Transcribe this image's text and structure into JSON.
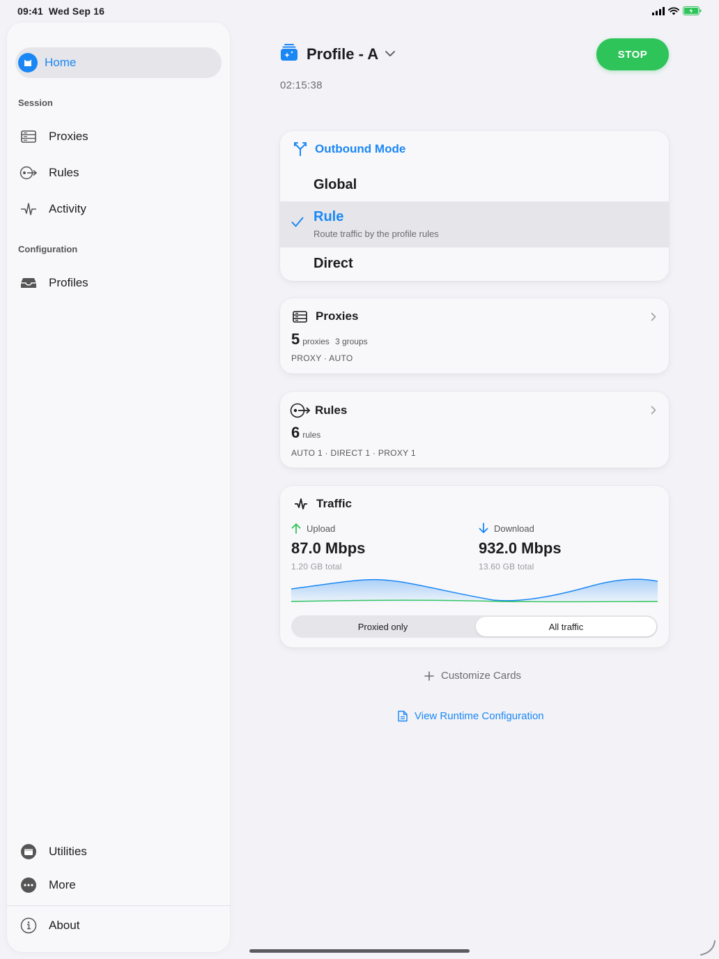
{
  "status_bar": {
    "time": "09:41",
    "date": "Wed Sep 16"
  },
  "sidebar": {
    "home": "Home",
    "session_header": "Session",
    "session_items": [
      "Proxies",
      "Rules",
      "Activity"
    ],
    "configuration_header": "Configuration",
    "configuration_items": [
      "Profiles"
    ],
    "utilities": "Utilities",
    "more": "More",
    "about": "About"
  },
  "header": {
    "profile_name": "Profile - A",
    "uptime": "02:15:38",
    "stop_label": "STOP"
  },
  "outbound": {
    "title": "Outbound Mode",
    "options": [
      {
        "label": "Global",
        "selected": false
      },
      {
        "label": "Rule",
        "description": "Route traffic by the profile rules",
        "selected": true
      },
      {
        "label": "Direct",
        "selected": false
      }
    ]
  },
  "proxies_card": {
    "title": "Proxies",
    "count": "5",
    "count_unit": "proxies",
    "groups": "3 groups",
    "list": "PROXY · AUTO"
  },
  "rules_card": {
    "title": "Rules",
    "count": "6",
    "count_unit": "rules",
    "breakdown": "AUTO 1 · DIRECT 1 · PROXY 1"
  },
  "traffic_card": {
    "title": "Traffic",
    "upload_label": "Upload",
    "upload_value": "87.0 Mbps",
    "upload_total": "1.20 GB total",
    "download_label": "Download",
    "download_value": "932.0 Mbps",
    "download_total": "13.60 GB total",
    "segments": [
      "Proxied only",
      "All traffic"
    ],
    "selected_segment": "All traffic"
  },
  "actions": {
    "customize": "Customize Cards",
    "view_config": "View Runtime Configuration"
  },
  "colors": {
    "accent": "#1a87f5",
    "stop": "#2ec45a",
    "upload_arrow": "#2ec45a",
    "download_arrow": "#1a87f5"
  }
}
